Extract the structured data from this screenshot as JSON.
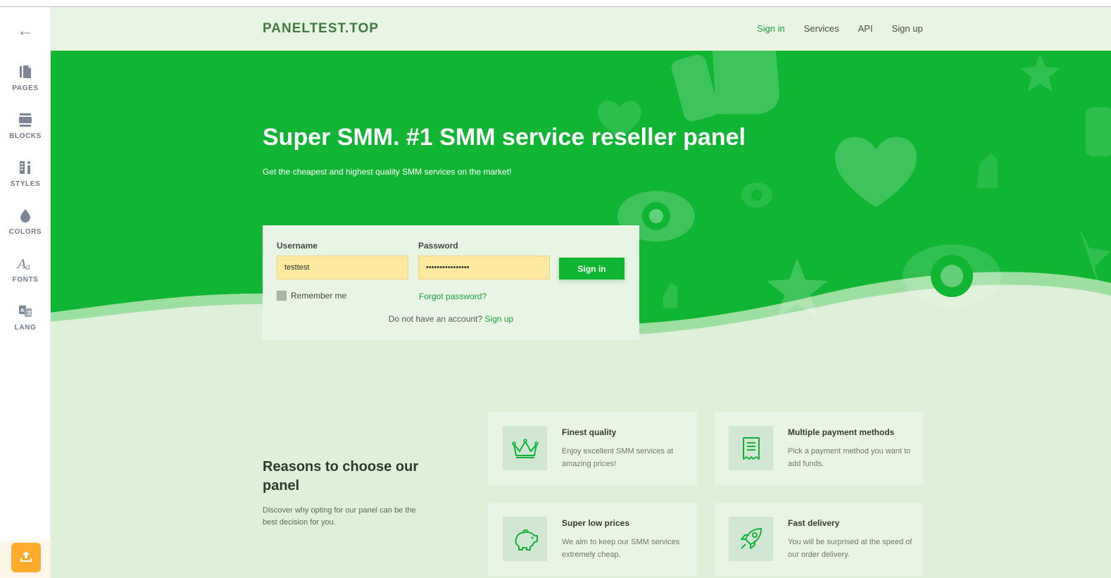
{
  "sidebar": {
    "items": [
      {
        "label": "PAGES",
        "icon": "pages-icon"
      },
      {
        "label": "BLOCKS",
        "icon": "blocks-icon"
      },
      {
        "label": "STYLES",
        "icon": "styles-icon"
      },
      {
        "label": "COLORS",
        "icon": "colors-icon"
      },
      {
        "label": "FONTS",
        "icon": "fonts-icon"
      },
      {
        "label": "LANG",
        "icon": "lang-icon"
      }
    ],
    "back_icon": "←"
  },
  "nav": {
    "brand": "PANELTEST.TOP",
    "links": [
      "Sign in",
      "Services",
      "API",
      "Sign up"
    ]
  },
  "hero": {
    "title": "Super SMM. #1 SMM service reseller panel",
    "subtitle": "Get the cheapest and highest quality SMM services on the market!"
  },
  "login": {
    "username_label": "Username",
    "username_value": "testtest",
    "password_label": "Password",
    "password_value": "testtesttesttest",
    "signin_label": "Sign in",
    "remember_label": "Remember me",
    "forgot_label": "Forgot password?",
    "no_account_text": "Do not have an account?",
    "signup_label": "Sign up"
  },
  "reasons": {
    "title": "Reasons to choose our panel",
    "subtitle": "Discover why opting for our panel can be the best decision for you.",
    "features": [
      {
        "title": "Finest quality",
        "desc": "Enjoy excellent SMM services at amazing prices!",
        "icon": "crown-icon"
      },
      {
        "title": "Multiple payment methods",
        "desc": "Pick a payment method you want to add funds.",
        "icon": "receipt-icon"
      },
      {
        "title": "Super low prices",
        "desc": "We aim to keep our SMM services extremely cheap.",
        "icon": "piggy-bank-icon"
      },
      {
        "title": "Fast delivery",
        "desc": "You will be surprised at the speed of our order delivery.",
        "icon": "rocket-icon"
      }
    ]
  },
  "colors": {
    "accent_green": "#10b534",
    "page_bg": "#dff0d8",
    "publish_orange": "#ffab2e"
  }
}
